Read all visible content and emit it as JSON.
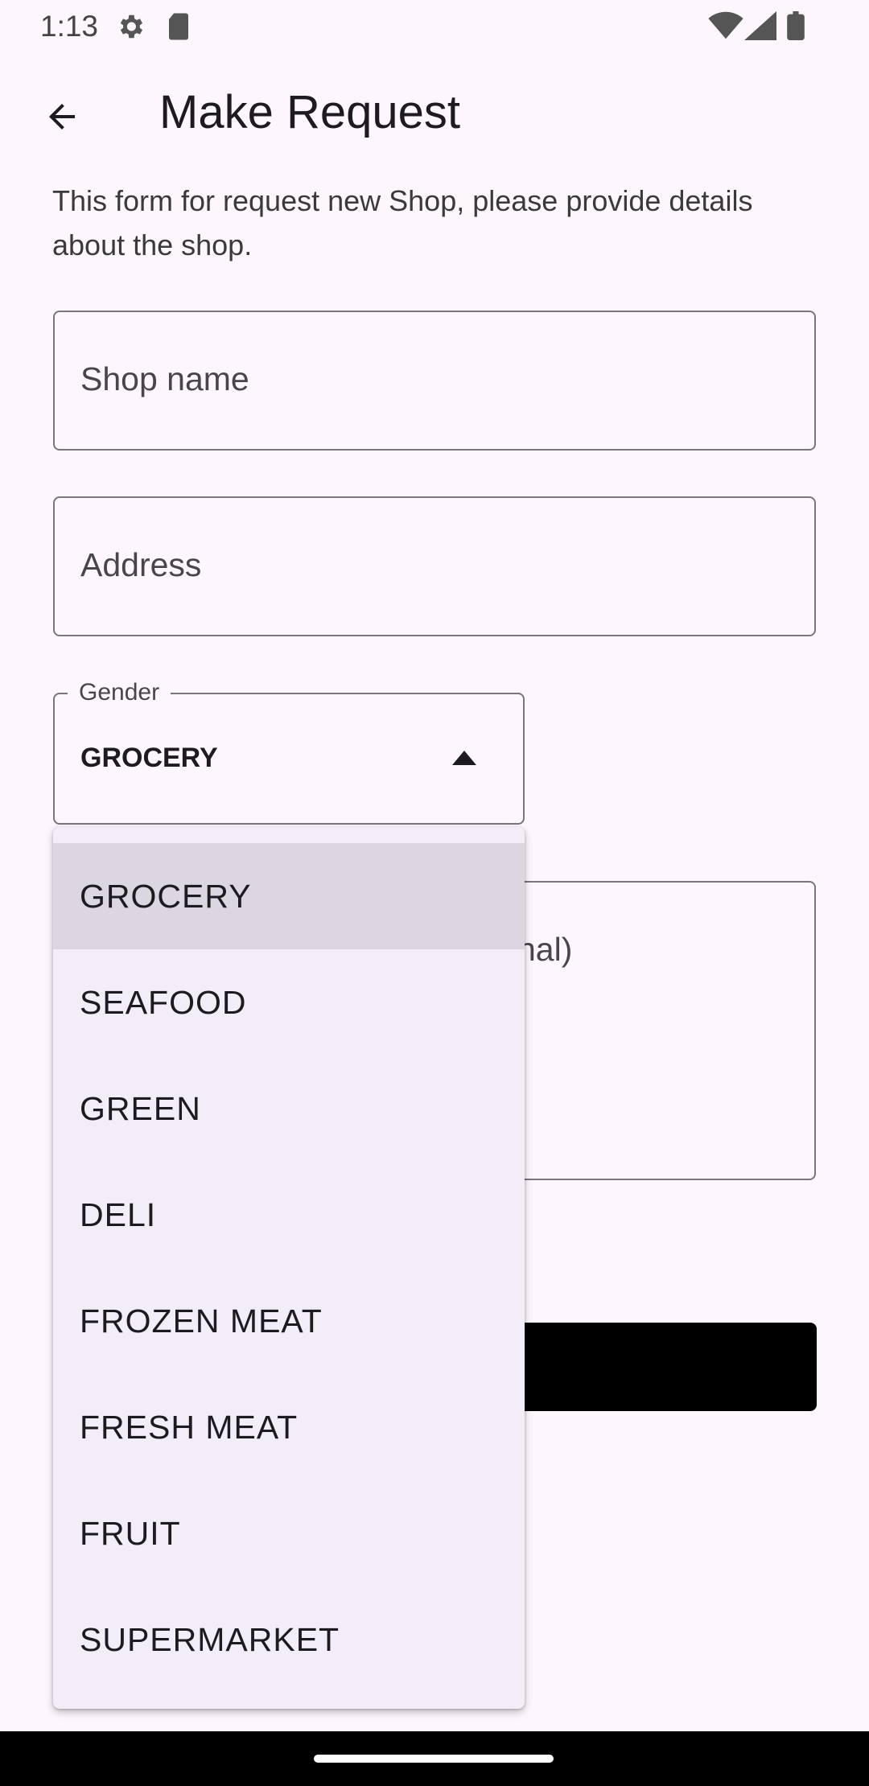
{
  "status_bar": {
    "time": "1:13",
    "icons": [
      "settings-icon",
      "sd-card-icon",
      "wifi-icon",
      "signal-icon",
      "battery-icon"
    ]
  },
  "app_bar": {
    "back_icon": "arrow-back-icon",
    "title": "Make Request"
  },
  "form": {
    "description": "This form for request new Shop, please provide details about the shop.",
    "shop_name_placeholder": "Shop name",
    "address_placeholder": "Address",
    "gender_label": "Gender",
    "gender_value": "GROCERY",
    "description_placeholder_partial": "nal)"
  },
  "dropdown": {
    "options": [
      "GROCERY",
      "SEAFOOD",
      "GREEN",
      "DELI",
      "FROZEN MEAT",
      "FRESH MEAT",
      "FRUIT",
      "SUPERMARKET"
    ],
    "selected": "GROCERY"
  },
  "colors": {
    "background": "#fdf7fd",
    "menu_background": "#f2edf8",
    "menu_selected": "#dcd6e2",
    "outline": "#79747e",
    "button": "#000000"
  }
}
